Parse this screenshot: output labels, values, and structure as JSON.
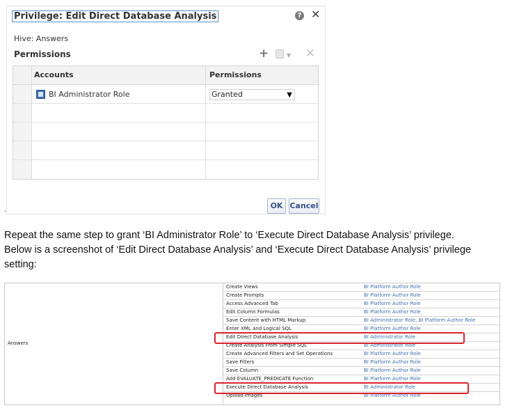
{
  "dialog": {
    "title": "Privilege: Edit Direct Database Analysis",
    "hive": "Hive: Answers",
    "permissions_heading": "Permissions",
    "toolbar": {
      "add": "+",
      "remove": "✕"
    },
    "table": {
      "headers": [
        "Accounts",
        "Permissions"
      ],
      "rows": [
        {
          "account": "BI Administrator Role",
          "permission": "Granted"
        }
      ]
    },
    "ok_label": "OK",
    "cancel_label": "Cancel"
  },
  "stray_mark": ".",
  "body_text": {
    "line1": "Repeat the same step to grant ‘BI Administrator Role’ to ‘Execute Direct Database Analysis’ privilege.",
    "line2": "Below is a screenshot of ‘Edit Direct Database Analysis’ and ‘Execute Direct Database Analysis’ privilege",
    "line3": "setting:"
  },
  "privileges": {
    "section": "Answers",
    "rows": [
      {
        "name": "Create Views",
        "roles": "BI Platform Author Role"
      },
      {
        "name": "Create Prompts",
        "roles": "BI Platform Author Role"
      },
      {
        "name": "Access Advanced Tab",
        "roles": "BI Platform Author Role"
      },
      {
        "name": "Edit Column Formulas",
        "roles": "BI Platform Author Role"
      },
      {
        "name": "Save Content with HTML Markup",
        "roles": "BI Administrator Role, BI Platform Author Role"
      },
      {
        "name": "Enter XML and Logical SQL",
        "roles": "BI Platform Author Role"
      },
      {
        "name": "Edit Direct Database Analysis",
        "roles": "BI Administrator Role"
      },
      {
        "name": "Create Analysis From Simple SQL",
        "roles": "BI Administrator Role"
      },
      {
        "name": "Create Advanced Filters and Set Operations",
        "roles": "BI Platform Author Role"
      },
      {
        "name": "Save Filters",
        "roles": "BI Platform Author Role"
      },
      {
        "name": "Save Column",
        "roles": "BI Platform Author Role"
      },
      {
        "name": "Add EVALUATE_PREDICATE Function",
        "roles": "BI Platform Author Role"
      },
      {
        "name": "Execute Direct Database Analysis",
        "roles": "BI Administrator Role"
      },
      {
        "name": "Upload Images",
        "roles": "BI Platform Author Role"
      }
    ]
  }
}
